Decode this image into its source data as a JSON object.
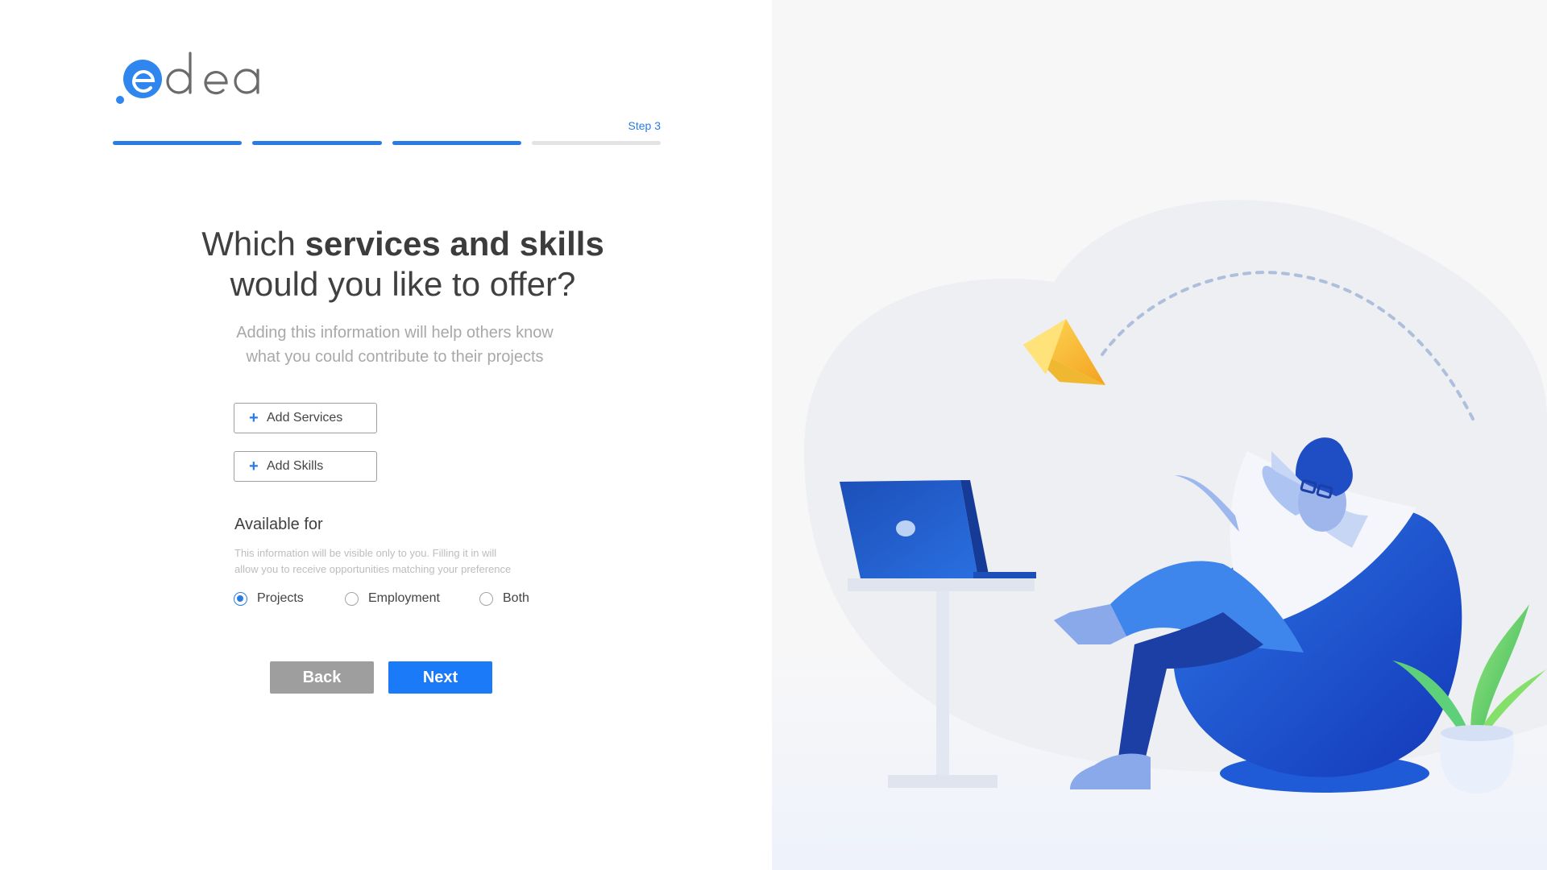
{
  "logo": {
    "text": "edea"
  },
  "progress": {
    "step_label": "Step 3",
    "total_steps": 4,
    "completed_steps": 3
  },
  "headline": {
    "line1_prefix": "Which ",
    "line1_bold": "services and skills",
    "line2": "would you like to offer?"
  },
  "subtitle": {
    "line1": "Adding this information will help others know",
    "line2": "what you could contribute to their projects"
  },
  "buttons": {
    "add_services": "Add Services",
    "add_skills": "Add Skills",
    "back": "Back",
    "next": "Next"
  },
  "available_for": {
    "title": "Available for",
    "note_line1": "This information will be visible only to you. Filling it in will",
    "note_line2": "allow you to receive opportunities matching your preference",
    "options": [
      "Projects",
      "Employment",
      "Both"
    ],
    "selected": "Projects"
  },
  "colors": {
    "accent": "#1a7af8",
    "back_button": "#9e9e9e",
    "progress_done": "#2a7be2",
    "progress_todo": "#e3e3e3"
  },
  "icons": {
    "plus": "plus-icon",
    "paper_plane": "paper-plane-icon",
    "laptop": "laptop-icon",
    "plant": "plant-icon"
  }
}
